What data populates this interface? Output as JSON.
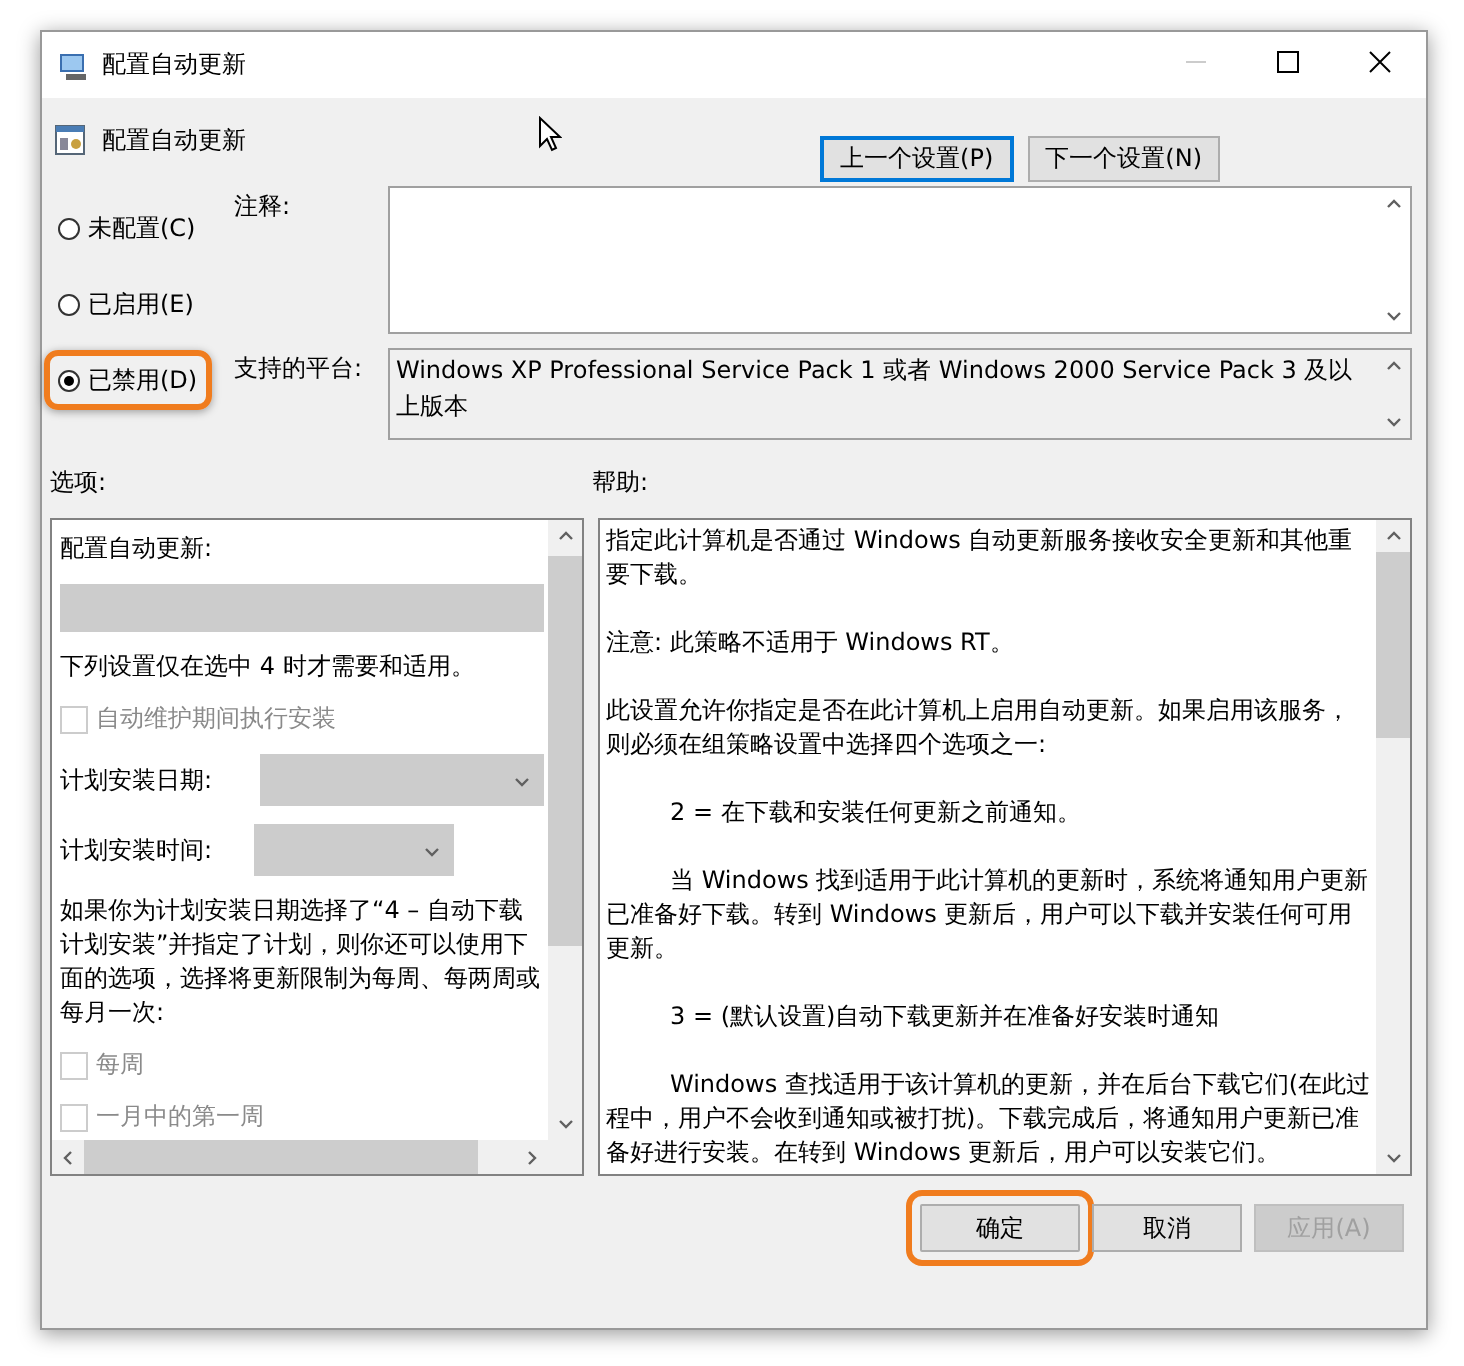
{
  "window": {
    "title": "配置自动更新"
  },
  "header": {
    "title": "配置自动更新"
  },
  "nav_buttons": [
    {
      "label": "上一个设置(P)",
      "focused": true
    },
    {
      "label": "下一个设置(N)",
      "focused": false
    }
  ],
  "state_options": [
    {
      "label": "未配置(C)",
      "selected": false,
      "highlighted": false
    },
    {
      "label": "已启用(E)",
      "selected": false,
      "highlighted": false
    },
    {
      "label": "已禁用(D)",
      "selected": true,
      "highlighted": true
    }
  ],
  "comment": {
    "label": "注释:"
  },
  "platform": {
    "label": "支持的平台:",
    "text": "Windows XP Professional Service Pack 1 或者 Windows 2000 Service Pack 3 及以上版本"
  },
  "options": {
    "label": "选项:",
    "items": [
      {
        "kind": "text",
        "text": "配置自动更新:"
      },
      {
        "kind": "dropdown",
        "disabled": true
      },
      {
        "kind": "text",
        "text": "下列设置仅在选中 4 时才需要和适用。"
      },
      {
        "kind": "checkbox",
        "label": "自动维护期间执行安装",
        "checked": false,
        "disabled": true
      },
      {
        "kind": "select",
        "label": "计划安装日期:",
        "disabled": true,
        "wide": true
      },
      {
        "kind": "select",
        "label": "计划安装时间:",
        "disabled": true,
        "wide": false
      },
      {
        "kind": "text",
        "text": "如果你为计划安装日期选择了“4 – 自动下载计划安装”并指定了计划，则你还可以使用下面的选项，选择将更新限制为每周、每两周或每月一次:"
      },
      {
        "kind": "checkbox",
        "label": "每周",
        "checked": false,
        "disabled": true
      },
      {
        "kind": "checkbox",
        "label": "一月中的第一周",
        "checked": false,
        "disabled": true
      }
    ]
  },
  "help": {
    "label": "帮助:",
    "paragraphs": [
      {
        "kind": "plain",
        "text": "指定此计算机是否通过 Windows 自动更新服务接收安全更新和其他重要下载。"
      },
      {
        "kind": "plain",
        "text": "注意: 此策略不适用于 Windows RT。"
      },
      {
        "kind": "plain",
        "text": "此设置允许你指定是否在此计算机上启用自动更新。如果启用该服务，则必须在组策略设置中选择四个选项之一:"
      },
      {
        "kind": "indented",
        "text": "2 = 在下载和安装任何更新之前通知。"
      },
      {
        "kind": "indented",
        "text": "当 Windows 找到适用于此计算机的更新时，系统将通知用户更新已准备好下载。转到 Windows 更新后，用户可以下载并安装任何可用更新。"
      },
      {
        "kind": "indented",
        "text": "3 = (默认设置)自动下载更新并在准备好安装时通知"
      },
      {
        "kind": "indented",
        "text": "Windows 查找适用于该计算机的更新，并在后台下载它们(在此过程中，用户不会收到通知或被打扰)。下载完成后，将通知用户更新已准备好进行安装。在转到 Windows 更新后，用户可以安装它们。"
      }
    ]
  },
  "buttons": [
    {
      "label": "确定",
      "disabled": false,
      "highlighted": true
    },
    {
      "label": "取消",
      "disabled": false,
      "highlighted": false
    },
    {
      "label": "应用(A)",
      "disabled": true,
      "highlighted": false
    }
  ]
}
